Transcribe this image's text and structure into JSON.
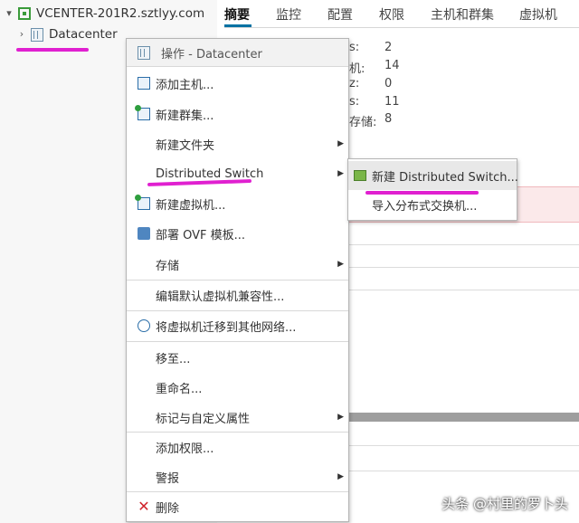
{
  "tree": {
    "root_label": "VCENTER-201R2.sztlyy.com",
    "datacenter_label": "Datacenter"
  },
  "tabs": [
    "摘要",
    "监控",
    "配置",
    "权限",
    "主机和群集",
    "虚拟机"
  ],
  "summary_bg": {
    "labels": [
      "s:",
      "机:",
      "z:",
      "s:",
      "存储:"
    ],
    "values": [
      "2",
      "14",
      "0",
      "11",
      "8"
    ]
  },
  "menu": {
    "title": "操作 - Datacenter",
    "items": [
      {
        "label": "添加主机..."
      },
      {
        "label": "新建群集..."
      },
      {
        "label": "新建文件夹"
      },
      {
        "label": "Distributed Switch"
      },
      {
        "label": "新建虚拟机..."
      },
      {
        "label": "部署 OVF 模板..."
      },
      {
        "label": "存储"
      },
      {
        "label": "编辑默认虚拟机兼容性..."
      },
      {
        "label": "将虚拟机迁移到其他网络..."
      },
      {
        "label": "移至..."
      },
      {
        "label": "重命名..."
      },
      {
        "label": "标记与自定义属性"
      },
      {
        "label": "添加权限..."
      },
      {
        "label": "警报"
      },
      {
        "label": "删除"
      }
    ]
  },
  "submenu": {
    "items": [
      {
        "label": "新建 Distributed Switch..."
      },
      {
        "label": "导入分布式交换机..."
      }
    ]
  },
  "watermark": "头条 @村里的罗卜头",
  "colors": {
    "annotation_underline": "#e020d0",
    "accent": "#0072a3",
    "alert_band": "#fbe9ea"
  }
}
